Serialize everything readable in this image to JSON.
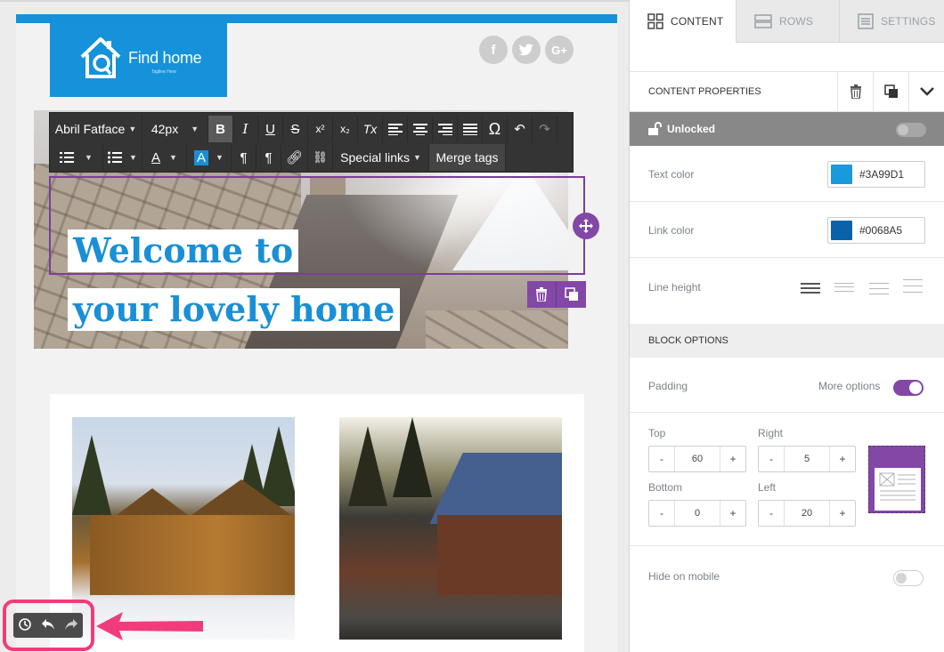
{
  "email": {
    "logo_text": "Find home",
    "logo_tagline": "Tagline Here",
    "social": [
      "f",
      "t",
      "G+"
    ],
    "headline_line1": "Welcome to",
    "headline_line2": " your lovely home"
  },
  "toolbar": {
    "font_family": "Abril Fatface",
    "font_size": "42px",
    "bold": "B",
    "italic": "I",
    "underline": "U",
    "strike": "S",
    "superscript": "x²",
    "subscript": "x₂",
    "clear_format": "Tx",
    "omega": "Ω",
    "special_links": "Special links",
    "merge_tags": "Merge tags"
  },
  "sidebar": {
    "tabs": [
      {
        "label": "CONTENT",
        "active": true
      },
      {
        "label": "ROWS",
        "active": false
      },
      {
        "label": "SETTINGS",
        "active": false
      }
    ],
    "content_properties_title": "CONTENT PROPERTIES",
    "lock_label": "Unlocked",
    "text_color_label": "Text color",
    "text_color_value": "#3A99D1",
    "link_color_label": "Link color",
    "link_color_value": "#0068A5",
    "line_height_label": "Line height",
    "block_options_title": "BLOCK OPTIONS",
    "padding_label": "Padding",
    "more_options_label": "More options",
    "padding": {
      "top_label": "Top",
      "top_value": "60",
      "right_label": "Right",
      "right_value": "5",
      "bottom_label": "Bottom",
      "bottom_value": "0",
      "left_label": "Left",
      "left_value": "20",
      "minus": "-",
      "plus": "+"
    },
    "hide_on_mobile_label": "Hide on mobile"
  },
  "colors": {
    "accent_purple": "#8347a6",
    "brand_blue": "#1592da",
    "highlight_pink": "#f23b7a"
  }
}
